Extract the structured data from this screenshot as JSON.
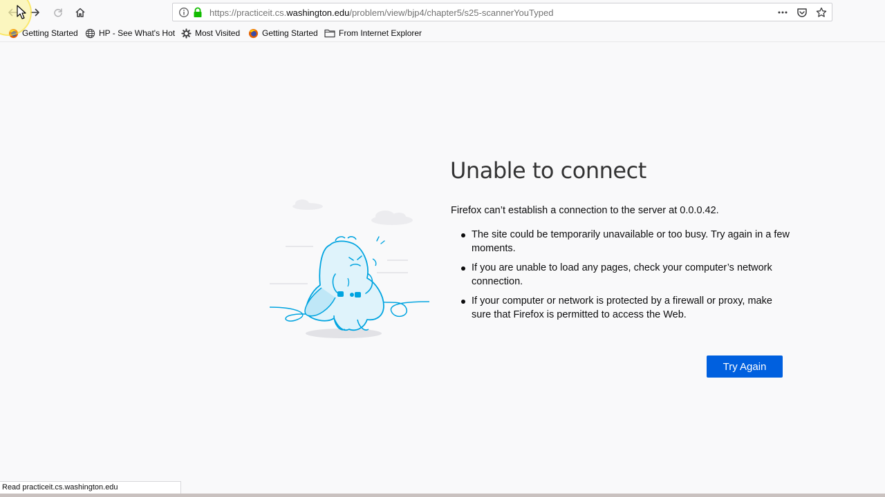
{
  "browser": {
    "url": {
      "prefix": "https://practiceit.cs.",
      "host": "washington.edu",
      "path": "/problem/view/bjp4/chapter5/s25-scannerYouTyped"
    },
    "bookmarks": [
      {
        "label": "Getting Started",
        "icon": "firefox-icon"
      },
      {
        "label": "HP - See What's Hot",
        "icon": "globe-icon"
      },
      {
        "label": "Most Visited",
        "icon": "gear-icon"
      },
      {
        "label": "Getting Started",
        "icon": "firefox-icon"
      },
      {
        "label": "From Internet Explorer",
        "icon": "folder-icon"
      }
    ],
    "status_text": "Read practiceit.cs.washington.edu"
  },
  "error_page": {
    "title": "Unable to connect",
    "description": "Firefox can’t establish a connection to the server at 0.0.0.42.",
    "tips": [
      "The site could be temporarily unavailable or too busy. Try again in a few moments.",
      "If you are unable to load any pages, check your computer’s network connection.",
      "If your computer or network is protected by a firewall or proxy, make sure that Firefox is permitted to access the Web."
    ],
    "try_again_label": "Try Again"
  },
  "colors": {
    "accent_button": "#0060df",
    "page_background": "#f9f9fa",
    "lock_green": "#12bc00",
    "illustration_blue": "#00a4e0"
  }
}
